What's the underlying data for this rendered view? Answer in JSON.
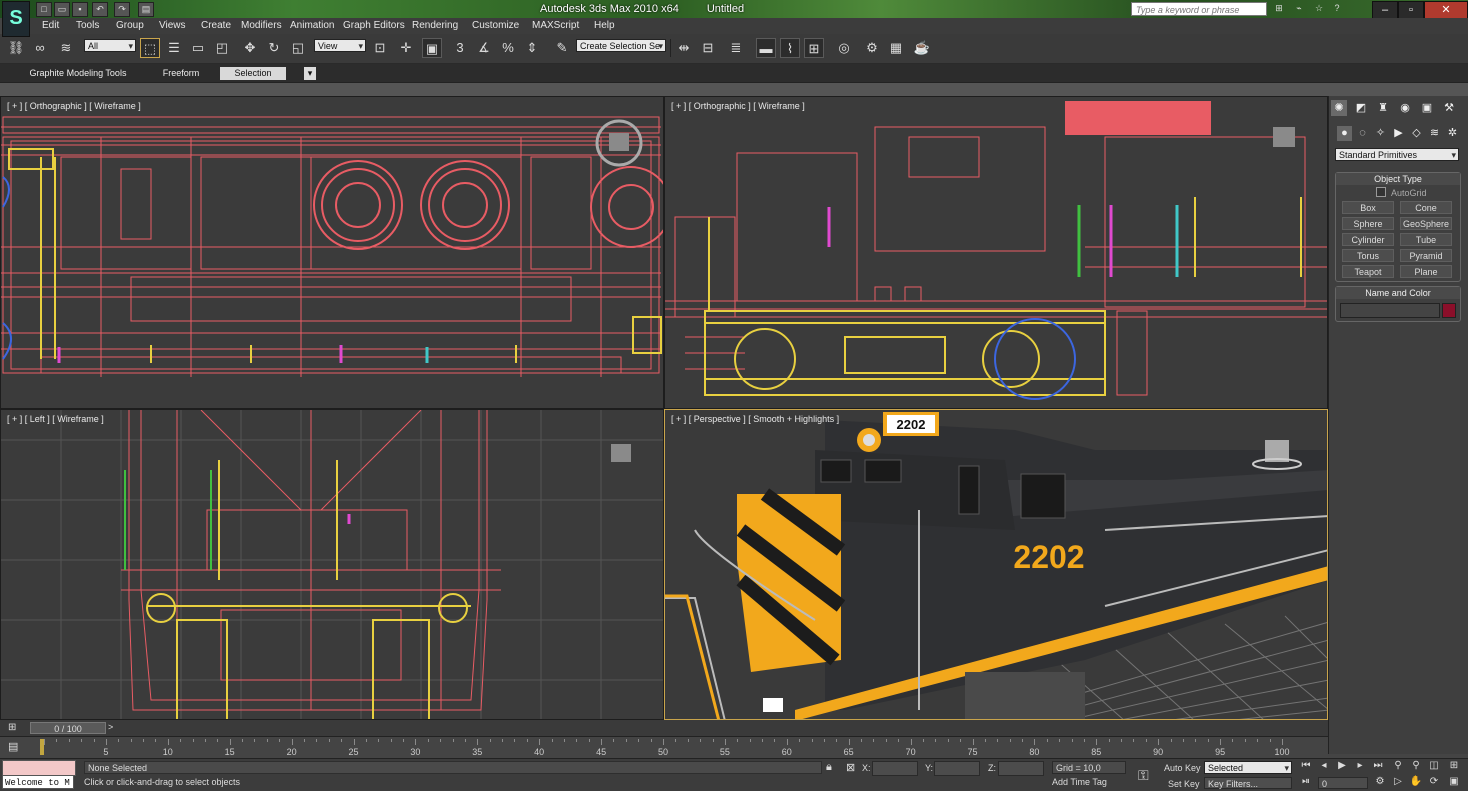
{
  "title": {
    "app": "Autodesk 3ds Max  2010 x64",
    "document": "Untitled",
    "search_placeholder": "Type a keyword or phrase"
  },
  "menu": [
    "Edit",
    "Tools",
    "Group",
    "Views",
    "Create",
    "Modifiers",
    "Animation",
    "Graph Editors",
    "Rendering",
    "Customize",
    "MAXScript",
    "Help"
  ],
  "toolbar": {
    "filter_value": "All",
    "refcoord_value": "View",
    "selection_set_placeholder": "Create Selection Se",
    "snap_labels": [
      "3",
      "%"
    ]
  },
  "ribbon": {
    "tabs": [
      "Graphite Modeling Tools",
      "Freeform",
      "Selection"
    ],
    "active_tab": "Selection"
  },
  "viewports": {
    "top": "[ + ] [ Orthographic ] [ Wireframe ]",
    "front": "[ + ] [ Orthographic ] [ Wireframe ]",
    "left": "[ + ] [ Left ] [ Wireframe ]",
    "perspective": "[ + ] [ Perspective ] [ Smooth + Highlights ]",
    "loco_number": "2202"
  },
  "command_panel": {
    "category": "Standard Primitives",
    "object_type_title": "Object Type",
    "autogrid": "AutoGrid",
    "buttons": [
      "Box",
      "Cone",
      "Sphere",
      "GeoSphere",
      "Cylinder",
      "Tube",
      "Torus",
      "Pyramid",
      "Teapot",
      "Plane"
    ],
    "name_color_title": "Name and Color",
    "color": "#8b0f2a"
  },
  "timeline": {
    "frame_range": "0 / 100",
    "ticks": [
      5,
      10,
      15,
      20,
      25,
      30,
      35,
      40,
      45,
      50,
      55,
      60,
      65,
      70,
      75,
      80,
      85,
      90,
      95,
      100
    ]
  },
  "status": {
    "maxscript_label": "Welcome to M",
    "selection": "None Selected",
    "prompt": "Click or click-and-drag to select objects",
    "x_label": "X:",
    "y_label": "Y:",
    "z_label": "Z:",
    "grid": "Grid = 10,0",
    "add_time_tag": "Add Time Tag",
    "auto_key": "Auto Key",
    "set_key": "Set Key",
    "selected_value": "Selected",
    "key_filters": "Key Filters...",
    "current_frame": "0"
  },
  "colors": {
    "wire_red": "#e85c64",
    "wire_yellow": "#e8d040",
    "wire_blue": "#3c66e0",
    "loco_body": "#2f3033",
    "loco_stripe": "#f2a81c",
    "active_border": "#c9a54c"
  }
}
